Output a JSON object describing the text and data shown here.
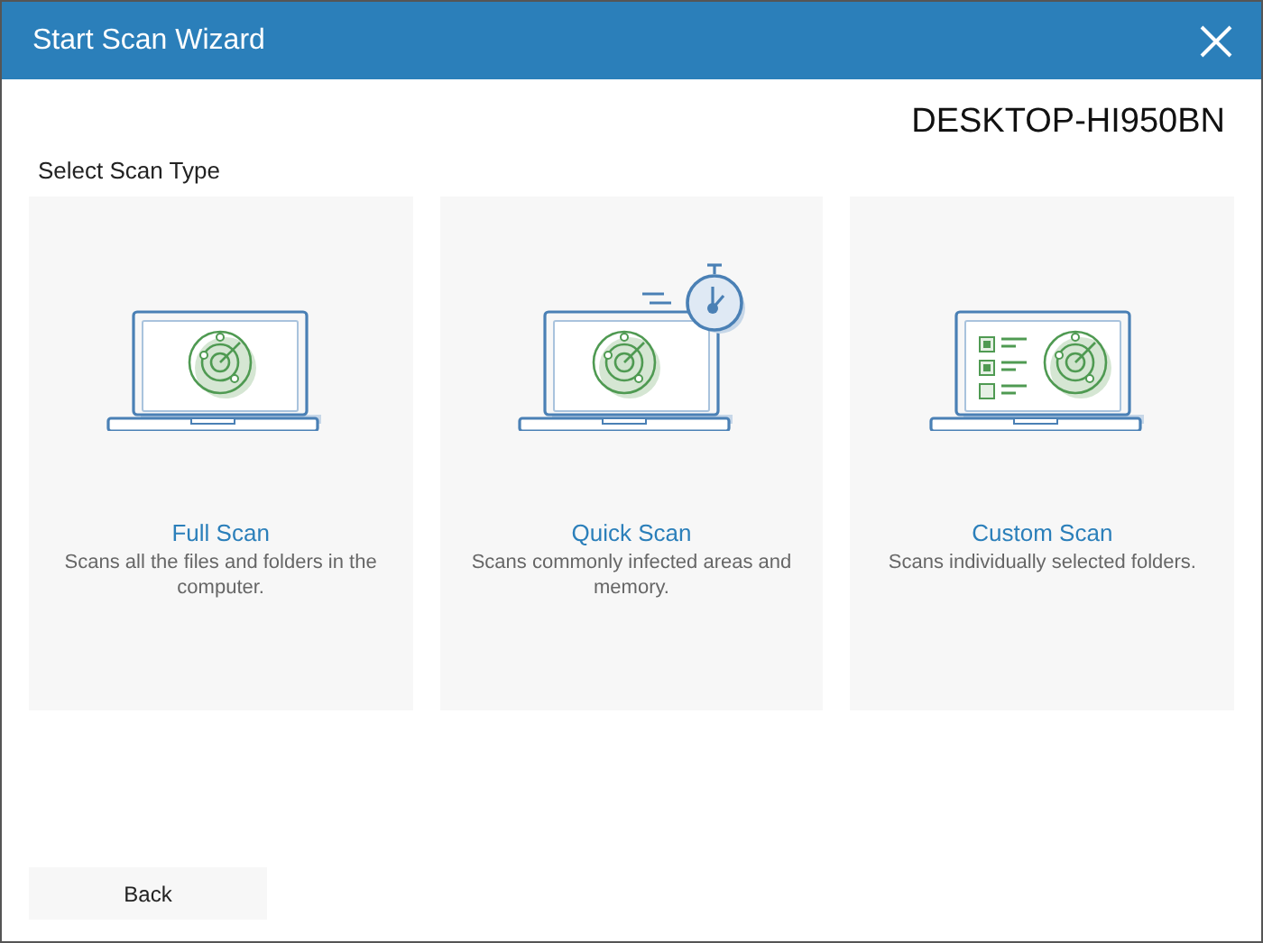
{
  "window": {
    "title": "Start Scan Wizard"
  },
  "computer_name": "DESKTOP-HI950BN",
  "section_label": "Select Scan Type",
  "scan_types": [
    {
      "kind": "full",
      "title": "Full Scan",
      "description": "Scans all the files and folders in the computer."
    },
    {
      "kind": "quick",
      "title": "Quick Scan",
      "description": "Scans commonly infected areas and memory."
    },
    {
      "kind": "custom",
      "title": "Custom Scan",
      "description": "Scans individually selected folders."
    }
  ],
  "buttons": [
    "Back"
  ]
}
